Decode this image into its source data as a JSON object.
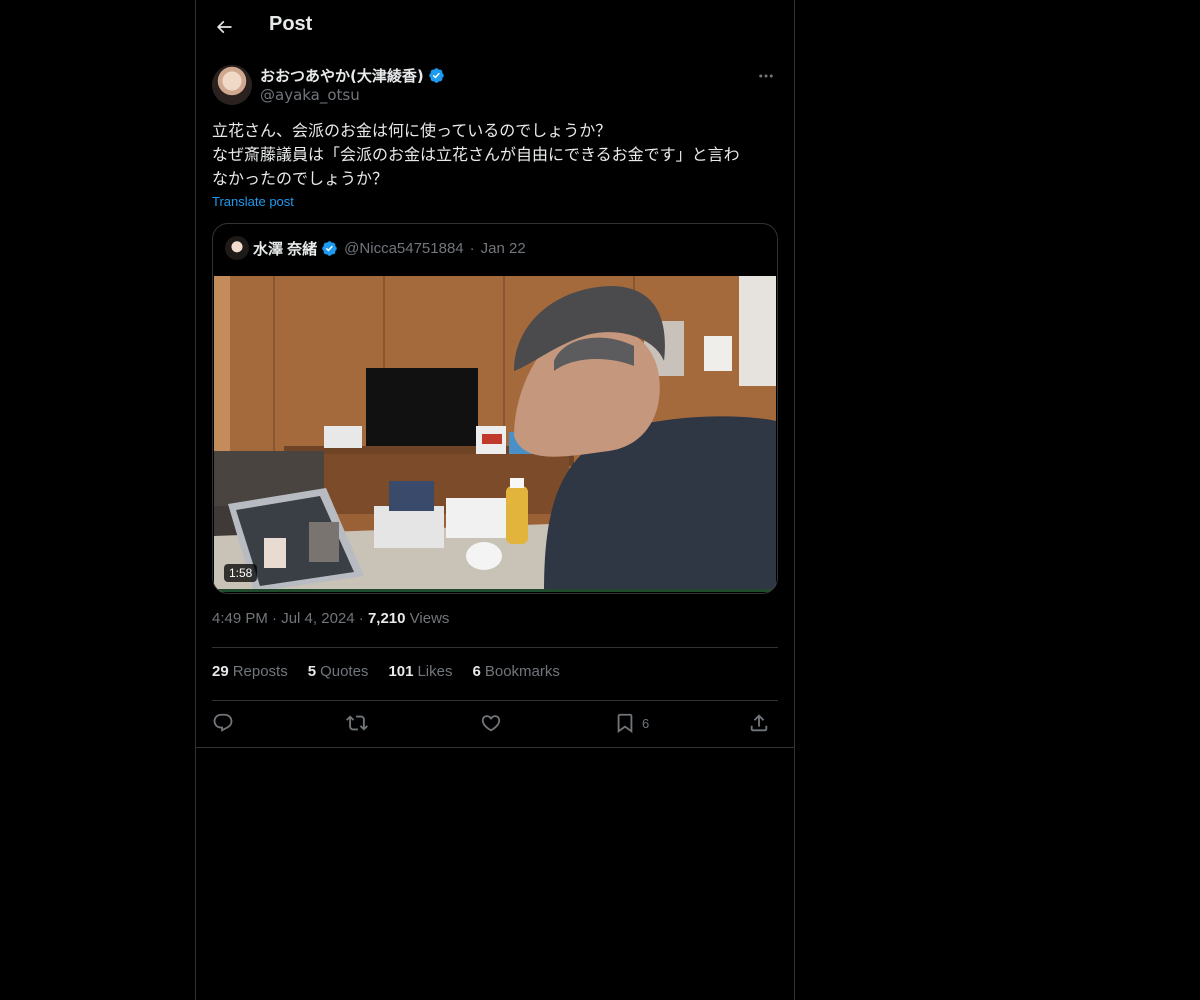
{
  "header": {
    "title": "Post",
    "back_icon": "arrow-left-icon"
  },
  "post": {
    "author": {
      "name": "おおつあやか(大津綾香)",
      "handle": "@ayaka_otsu",
      "verified": true
    },
    "text_lines": [
      "立花さん、会派のお金は何に使っているのでしょうか？",
      "なぜ斎藤議員は「会派のお金は立花さんが自由にできるお金です」と言わ",
      "なかったのでしょうか？"
    ],
    "translate_label": "Translate post",
    "quote": {
      "name": "水澤 奈緒",
      "handle": "@Nicca54751884",
      "date": "Jan 22",
      "video_duration": "1:58"
    },
    "time": "4:49 PM",
    "date": "Jul 4, 2024",
    "views_count": "7,210",
    "views_label": "Views",
    "stats": {
      "reposts_count": "29",
      "reposts_label": "Reposts",
      "quotes_count": "5",
      "quotes_label": "Quotes",
      "likes_count": "101",
      "likes_label": "Likes",
      "bookmarks_count": "6",
      "bookmarks_label": "Bookmarks"
    },
    "actions": {
      "bookmark_count": "6"
    }
  },
  "colors": {
    "background": "#000000",
    "text_primary": "#e7e9ea",
    "text_secondary": "#71767b",
    "accent": "#1d9bf0",
    "border": "#2f3336"
  }
}
